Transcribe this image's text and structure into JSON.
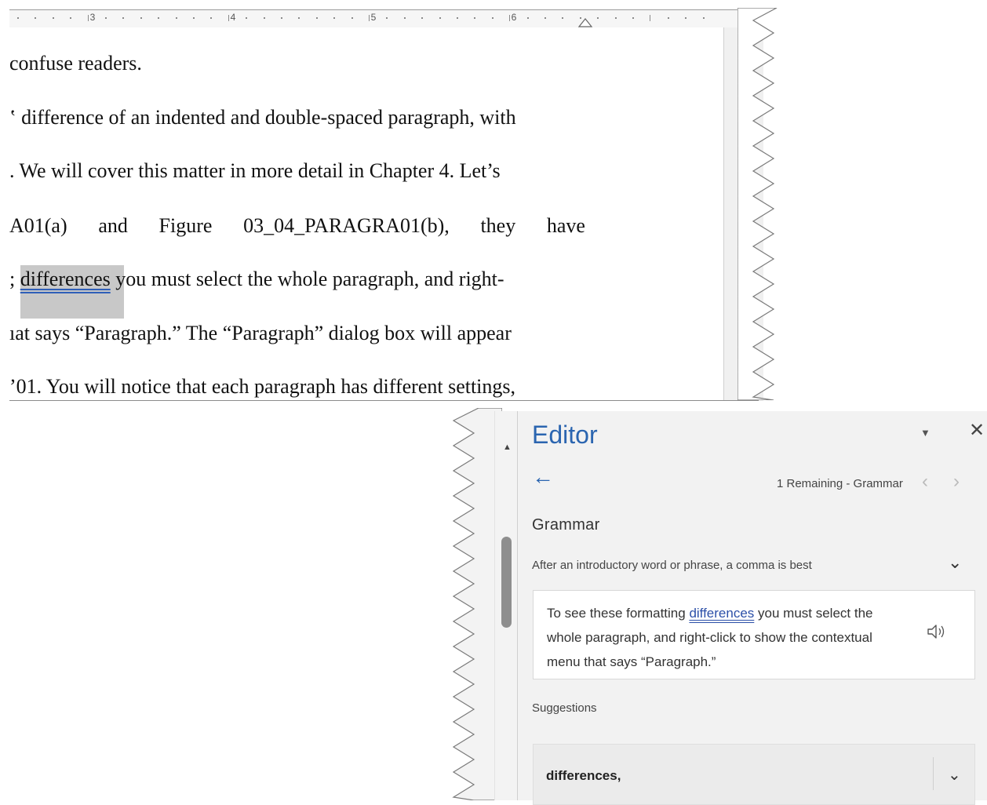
{
  "ruler": {
    "numbers": [
      "3",
      "4",
      "5",
      "6"
    ]
  },
  "document": {
    "lines": [
      "confuse readers.",
      "ʽ difference of an indented and double-spaced paragraph, with",
      ". We will cover this matter in more detail in Chapter 4. Let’s",
      [
        "A01(a)",
        "and",
        "Figure",
        "03_04_PARAGRA01(b),",
        "they",
        "have"
      ],
      {
        "pre": "; ",
        "flag": "differences",
        "post": " you must select the whole paragraph, and right-"
      },
      "ıat says “Paragraph.” The “Paragraph” dialog box will appear",
      "’01. You will notice that each paragraph has different settings,"
    ]
  },
  "editor": {
    "title": "Editor",
    "remaining": "1 Remaining - Grammar",
    "category": "Grammar",
    "rule": "After an introductory word or phrase, a comma is best",
    "context": {
      "before": "To see these formatting ",
      "flag": "differences",
      "after": " you must select the whole paragraph, and right-click to show the contextual menu that says “Paragraph.”"
    },
    "suggestions_label": "Suggestions",
    "suggestion": "differences,",
    "icons": {
      "close": "close-icon",
      "options": "caret-down-icon",
      "back": "back-arrow-icon",
      "prev": "chevron-left-icon",
      "next": "chevron-right-icon",
      "expand": "chevron-down-icon",
      "speaker": "speaker-icon"
    },
    "accent_color": "#2b65b0"
  }
}
